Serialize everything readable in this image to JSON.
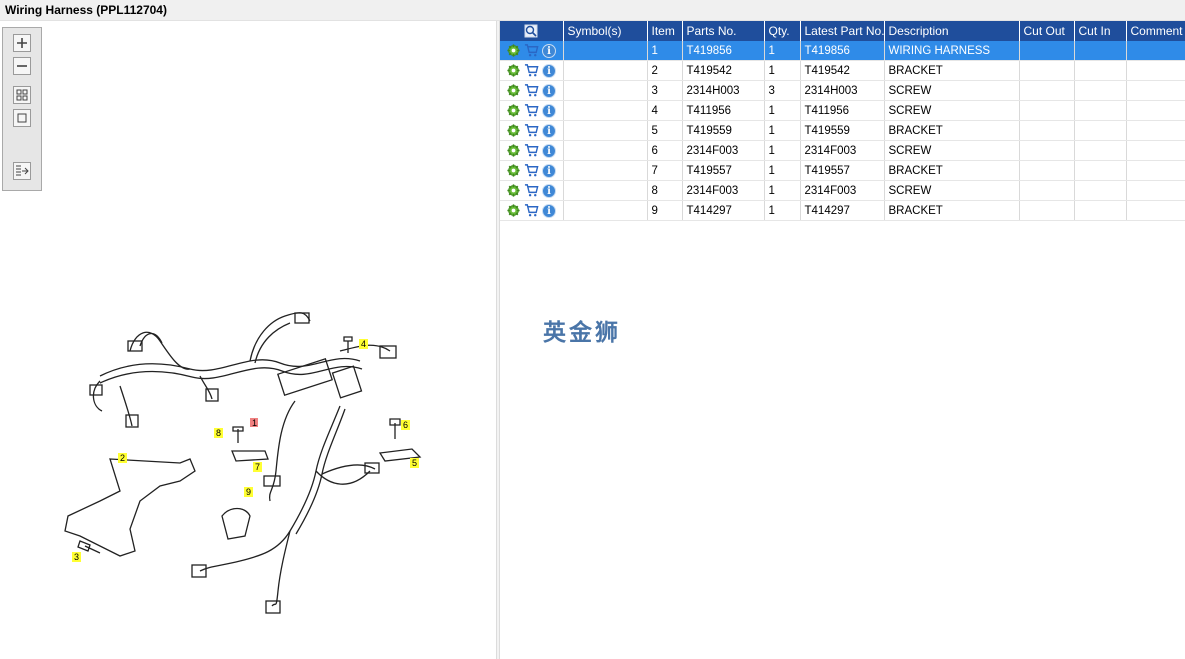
{
  "window": {
    "title": "Wiring Harness (PPL112704)"
  },
  "toolbar": {
    "zoom_in": "zoom-in-icon",
    "zoom_out": "zoom-out-icon",
    "fit": "fit-icon",
    "actual": "actual-size-icon",
    "export": "export-icon"
  },
  "table": {
    "columns": [
      "",
      "Symbol(s)",
      "Item",
      "Parts No.",
      "Qty.",
      "Latest Part No.",
      "Description",
      "Cut Out",
      "Cut In",
      "Comment"
    ],
    "rows": [
      {
        "item": "1",
        "part_no": "T419856",
        "qty": "1",
        "latest": "T419856",
        "desc": "WIRING HARNESS",
        "selected": true
      },
      {
        "item": "2",
        "part_no": "T419542",
        "qty": "1",
        "latest": "T419542",
        "desc": "BRACKET"
      },
      {
        "item": "3",
        "part_no": "2314H003",
        "qty": "3",
        "latest": "2314H003",
        "desc": "SCREW"
      },
      {
        "item": "4",
        "part_no": "T411956",
        "qty": "1",
        "latest": "T411956",
        "desc": "SCREW"
      },
      {
        "item": "5",
        "part_no": "T419559",
        "qty": "1",
        "latest": "T419559",
        "desc": "BRACKET"
      },
      {
        "item": "6",
        "part_no": "2314F003",
        "qty": "1",
        "latest": "2314F003",
        "desc": "SCREW"
      },
      {
        "item": "7",
        "part_no": "T419557",
        "qty": "1",
        "latest": "T419557",
        "desc": "BRACKET"
      },
      {
        "item": "8",
        "part_no": "2314F003",
        "qty": "1",
        "latest": "2314F003",
        "desc": "SCREW"
      },
      {
        "item": "9",
        "part_no": "T414297",
        "qty": "1",
        "latest": "T414297",
        "desc": "BRACKET"
      }
    ]
  },
  "diagram": {
    "callouts": [
      "1",
      "2",
      "3",
      "4",
      "5",
      "6",
      "7",
      "8",
      "9"
    ]
  },
  "watermark": "英金狮",
  "colors": {
    "header": "#1f4e9c",
    "selected_row": "#2f8be8",
    "callout": "#ffff33",
    "callout_active": "#f08080"
  }
}
